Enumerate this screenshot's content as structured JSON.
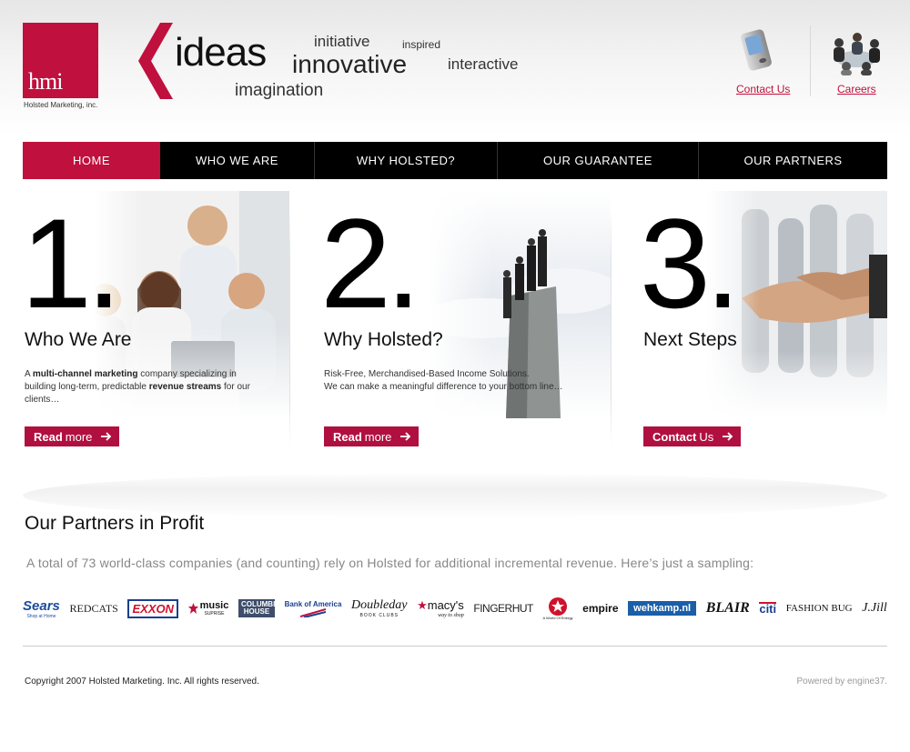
{
  "brand": {
    "logo_text": "hmi",
    "company_name": "Holsted Marketing, inc.",
    "color": "#c0103d"
  },
  "tagline_words": {
    "ideas": "ideas",
    "initiative": "initiative",
    "inspired": "inspired",
    "innovative": "innovative",
    "interactive": "interactive",
    "imagination": "imagination"
  },
  "header_links": {
    "contact": "Contact Us",
    "careers": "Careers"
  },
  "nav": [
    {
      "label": "HOME",
      "active": true
    },
    {
      "label": "WHO WE ARE",
      "active": false
    },
    {
      "label": "WHY HOLSTED?",
      "active": false
    },
    {
      "label": "OUR GUARANTEE",
      "active": false
    },
    {
      "label": "OUR PARTNERS",
      "active": false
    }
  ],
  "columns": [
    {
      "number": "1.",
      "heading": "Who We Are",
      "button": {
        "bold": "Read",
        "rest": "more"
      }
    },
    {
      "number": "2.",
      "heading": "Why Holsted?",
      "text_line1": "Risk-Free, Merchandised-Based Income Solutions.",
      "text_line2": "We can make a meaningful difference to your bottom line…",
      "button": {
        "bold": "Read",
        "rest": "more"
      }
    },
    {
      "number": "3.",
      "heading": "Next Steps",
      "button": {
        "bold": "Contact",
        "rest": "Us"
      }
    }
  ],
  "col1_text": {
    "p1": "A ",
    "b1": "multi-channel marketing",
    "p2": " company specializing in building long-term, predictable ",
    "b2": "revenue streams",
    "p3": " for our clients…"
  },
  "partners": {
    "title": "Our Partners in Profit",
    "description": "A total of 73 world-class companies (and counting) rely on Holsted for additional incremental revenue. Here’s just a sampling:",
    "logos": [
      "Sears",
      "REDCATS",
      "EXXON",
      "music",
      "COLUMBIA HOUSE",
      "Bank of America",
      "Doubleday",
      "macy's",
      "FINGERHUT",
      "empire",
      "wehkamp.nl",
      "BLAIR",
      "citi",
      "FASHION BUG",
      "J.Jill"
    ],
    "sears_sub": "Shop at Home",
    "doubleday_sub": "BOOK CLUBS",
    "macys_sub": "way to shop",
    "music_sub": "SUPRISE",
    "texaco_sub": "A World Of Energy"
  },
  "footer": {
    "copyright": "Copyright 2007 Holsted Marketing. Inc. All rights reserved.",
    "powered": "Powered by engine37."
  }
}
